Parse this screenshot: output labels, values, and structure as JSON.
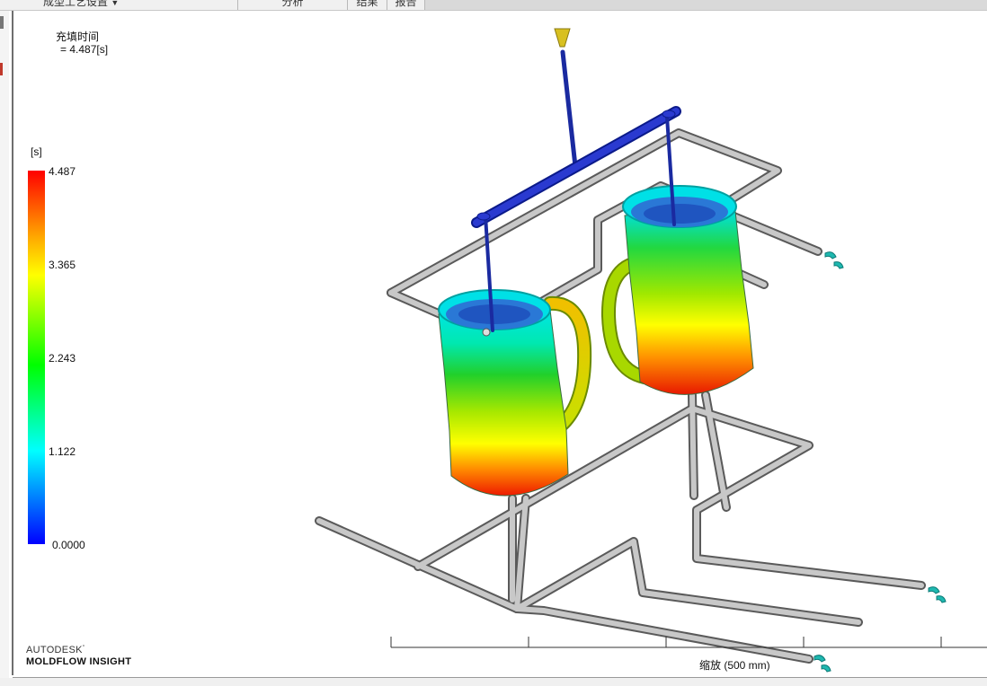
{
  "menu": {
    "tabs": [
      {
        "label": "成型工艺设置"
      },
      {
        "label": "分析"
      },
      {
        "label": "结果"
      },
      {
        "label": "报告"
      }
    ]
  },
  "result": {
    "title": "充填时间",
    "value": "= 4.487[s]"
  },
  "legend": {
    "unit": "[s]",
    "ticks": [
      "4.487",
      "3.365",
      "2.243",
      "1.122",
      "0.0000"
    ],
    "colors": [
      "#ff0000",
      "#ffff00",
      "#00ff00",
      "#00ffff",
      "#0000ff"
    ]
  },
  "scale": {
    "label": "缩放 (500 mm)"
  },
  "brand": {
    "line1": "AUTODESK",
    "line2": "MOLDFLOW INSIGHT"
  },
  "icons": {
    "dropdown": "chevron-down-icon",
    "injection": "injection-cone-icon",
    "coolant": "coolant-fitting-icon"
  }
}
